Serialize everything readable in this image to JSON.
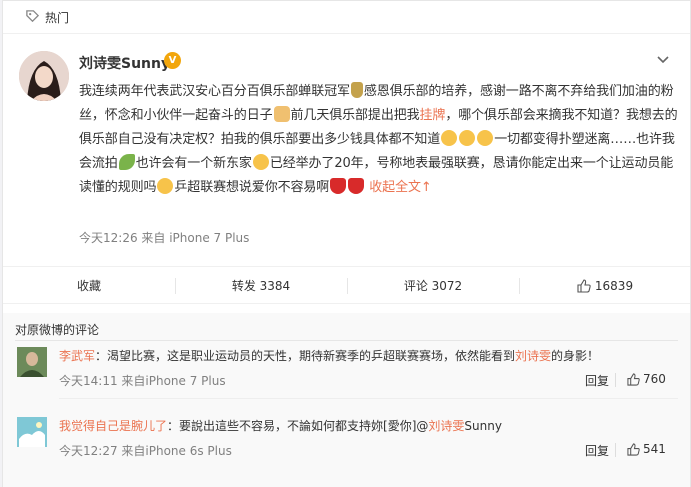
{
  "header": {
    "label": "热门"
  },
  "post": {
    "username": "刘诗雯Sunny",
    "badge": "V",
    "text": {
      "p1": "我连续两年代表武汉安心百分百俱乐部蝉联冠军",
      "p2": "感恩俱乐部的培养，感谢一路不离不弃给我们加油的粉丝，怀念和小伙伴一起奋斗的日子",
      "p3": "前几天俱乐部提出把我",
      "p3_link": "挂牌",
      "p4": "，哪个俱乐部会来摘我不知道？我想去的俱乐部自己没有决定权？拍我的俱乐部要出多少钱具体都不知道",
      "p5": "一切都变得扑塑迷离……也许我会流拍",
      "p6": "也许会有一个新东家",
      "p7": "已经举办了20年，号称地表最强联赛，恳请你能定出来一个让运动员能读懂的规则吗",
      "p8": "乒超联赛想说爱你不容易啊",
      "collapse": "收起全文",
      "collapse_arrow": "↑"
    },
    "meta": "今天12:26 来自 iPhone 7 Plus"
  },
  "actions": {
    "favorite": "收藏",
    "repost": "转发 3384",
    "comment": "评论 3072",
    "like": "16839"
  },
  "comments": {
    "header": "对原微博的评论",
    "items": [
      {
        "name": "李武军",
        "text": "：渴望比赛，这是职业运动员的天性，期待新赛季的乒超联赛赛场，依然能看到",
        "link": "刘诗雯",
        "text_after": "的身影！",
        "meta": "今天14:11 来自iPhone 7 Plus",
        "reply": "回复",
        "likes": "760"
      },
      {
        "name": "我觉得自己是腕儿了",
        "text": "：要說出這些不容易，不論如何都支持妳[愛你]@",
        "link": "刘诗雯",
        "text_after": "Sunny",
        "meta": "今天12:27 来自iPhone 6s Plus",
        "reply": "回复",
        "likes": "541"
      }
    ]
  }
}
